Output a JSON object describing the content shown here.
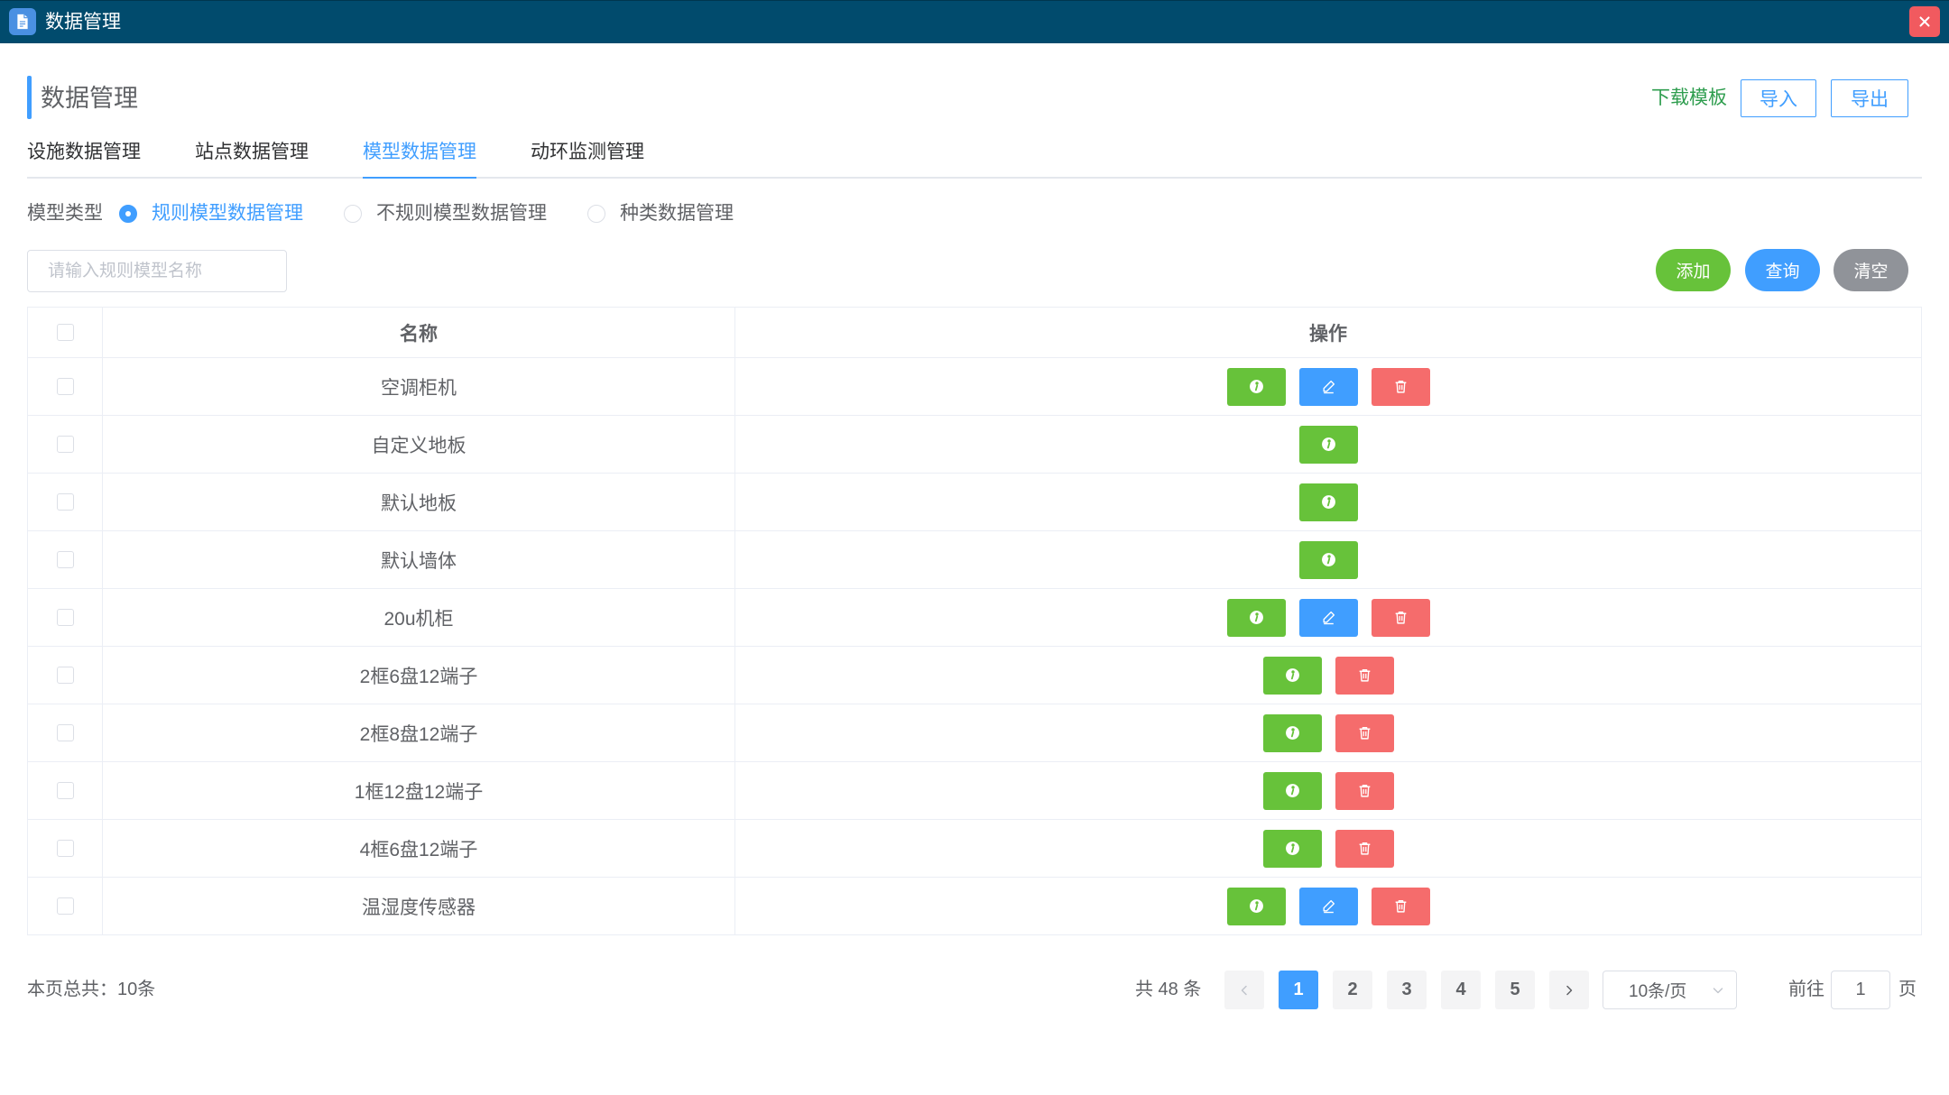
{
  "window": {
    "title": "数据管理",
    "app_icon": "document-icon",
    "close_icon": "close-icon"
  },
  "header": {
    "title": "数据管理",
    "download_template": "下载模板",
    "import_label": "导入",
    "export_label": "导出"
  },
  "tabs": {
    "items": [
      {
        "label": "设施数据管理",
        "active": false
      },
      {
        "label": "站点数据管理",
        "active": false
      },
      {
        "label": "模型数据管理",
        "active": true
      },
      {
        "label": "动环监测管理",
        "active": false
      }
    ]
  },
  "filter": {
    "label": "模型类型",
    "options": [
      {
        "label": "规则模型数据管理",
        "checked": true
      },
      {
        "label": "不规则模型数据管理",
        "checked": false
      },
      {
        "label": "种类数据管理",
        "checked": false
      }
    ]
  },
  "search": {
    "placeholder": "请输入规则模型名称",
    "value": ""
  },
  "toolbar": {
    "add_label": "添加",
    "query_label": "查询",
    "clear_label": "清空"
  },
  "table": {
    "columns": {
      "name": "名称",
      "actions": "操作"
    },
    "rows": [
      {
        "name": "空调柜机",
        "actions": [
          "info-icon",
          "edit-icon",
          "delete-icon"
        ]
      },
      {
        "name": "自定义地板",
        "actions": [
          "info-icon"
        ]
      },
      {
        "name": "默认地板",
        "actions": [
          "info-icon"
        ]
      },
      {
        "name": "默认墙体",
        "actions": [
          "info-icon"
        ]
      },
      {
        "name": "20u机柜",
        "actions": [
          "info-icon",
          "edit-icon",
          "delete-icon"
        ]
      },
      {
        "name": "2框6盘12端子",
        "actions": [
          "info-icon",
          "delete-icon"
        ]
      },
      {
        "name": "2框8盘12端子",
        "actions": [
          "info-icon",
          "delete-icon"
        ]
      },
      {
        "name": "1框12盘12端子",
        "actions": [
          "info-icon",
          "delete-icon"
        ]
      },
      {
        "name": "4框6盘12端子",
        "actions": [
          "info-icon",
          "delete-icon"
        ]
      },
      {
        "name": "温湿度传感器",
        "actions": [
          "info-icon",
          "edit-icon",
          "delete-icon"
        ]
      }
    ]
  },
  "footer": {
    "page_total": "本页总共：10条"
  },
  "pagination": {
    "total_text": "共 48 条",
    "prev_icon": "chevron-left-icon",
    "next_icon": "chevron-right-icon",
    "pages": [
      {
        "label": "1",
        "active": true
      },
      {
        "label": "2",
        "active": false
      },
      {
        "label": "3",
        "active": false
      },
      {
        "label": "4",
        "active": false
      },
      {
        "label": "5",
        "active": false
      }
    ],
    "page_size": "10条/页",
    "page_size_icon": "chevron-down-icon",
    "goto_label": "前往",
    "goto_value": "1",
    "goto_suffix": "页"
  },
  "colors": {
    "titlebar": "#014b6d",
    "primary": "#409eff",
    "success": "#67c23a",
    "danger": "#f56c6c",
    "neutral": "#909399",
    "download_link": "#2e9d4e",
    "close": "#f15a5f",
    "app_icon": "#4a90e2"
  }
}
